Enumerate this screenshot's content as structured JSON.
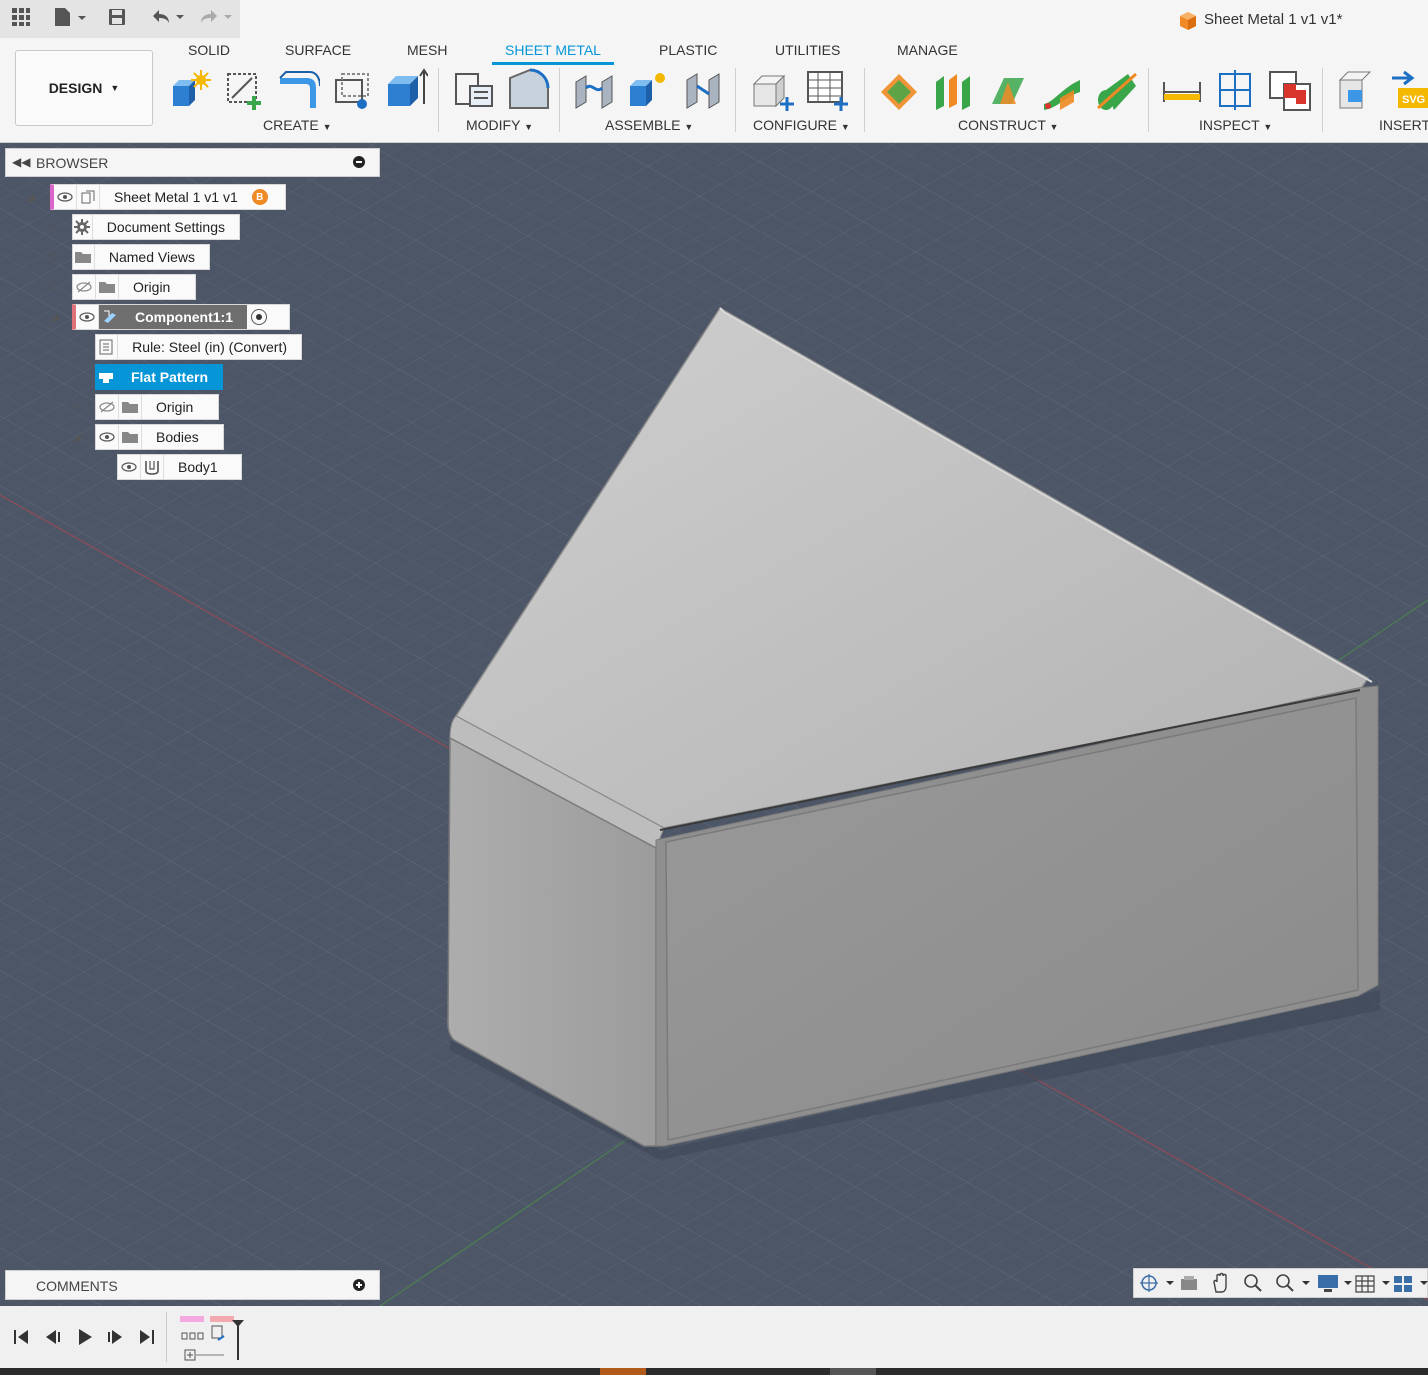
{
  "app": {
    "doc_title": "Sheet Metal 1 v1 v1*"
  },
  "workspace": {
    "label": "DESIGN"
  },
  "tabs": [
    {
      "label": "SOLID"
    },
    {
      "label": "SURFACE"
    },
    {
      "label": "MESH"
    },
    {
      "label": "SHEET METAL",
      "active": true
    },
    {
      "label": "PLASTIC"
    },
    {
      "label": "UTILITIES"
    },
    {
      "label": "MANAGE"
    }
  ],
  "groups": {
    "create": "CREATE",
    "modify": "MODIFY",
    "assemble": "ASSEMBLE",
    "configure": "CONFIGURE",
    "construct": "CONSTRUCT",
    "inspect": "INSPECT",
    "insert": "INSERT"
  },
  "browser": {
    "title": "BROWSER",
    "root": "Sheet Metal 1 v1 v1",
    "root_badge": "B",
    "document_settings": "Document Settings",
    "named_views": "Named Views",
    "origin": "Origin",
    "component": "Component1:1",
    "rule": "Rule: Steel (in) (Convert)",
    "flat_pattern": "Flat Pattern",
    "comp_origin": "Origin",
    "bodies": "Bodies",
    "body1": "Body1"
  },
  "comments": {
    "title": "COMMENTS"
  },
  "colors": {
    "accent": "#0696d7",
    "viewport": "#4d5667",
    "component_marker": "#e0707a",
    "root_marker": "#d966c8"
  },
  "icons": [
    "grid-menu-icon",
    "file-icon",
    "save-icon",
    "undo-icon",
    "redo-icon",
    "eye-icon",
    "eye-hidden-icon",
    "gear-icon",
    "folder-icon",
    "component-icon",
    "radio-activate-icon",
    "rule-icon",
    "flat-pattern-icon",
    "body-icon",
    "play-icon"
  ]
}
